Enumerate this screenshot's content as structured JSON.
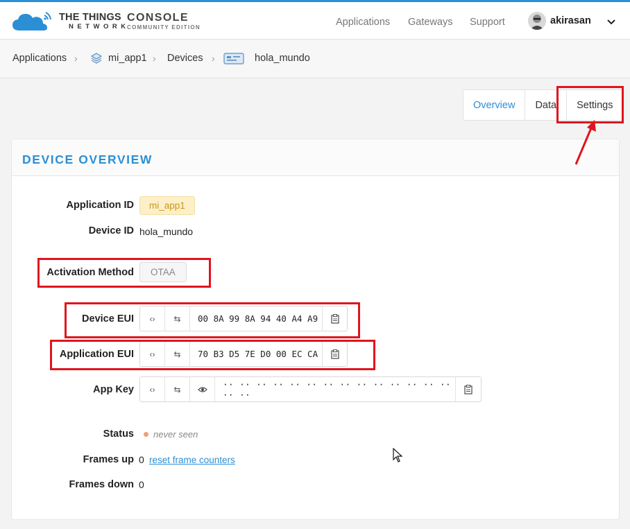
{
  "brand": {
    "line1": "THE THINGS",
    "line2": "NETWORK",
    "console": "CONSOLE",
    "edition": "COMMUNITY EDITION"
  },
  "nav": {
    "applications": "Applications",
    "gateways": "Gateways",
    "support": "Support",
    "username": "akirasan"
  },
  "breadcrumb": {
    "applications": "Applications",
    "app": "mi_app1",
    "devices": "Devices",
    "device": "hola_mundo"
  },
  "tabs": {
    "overview": "Overview",
    "data": "Data",
    "settings": "Settings"
  },
  "card": {
    "title": "DEVICE OVERVIEW",
    "application_id_label": "Application ID",
    "application_id": "mi_app1",
    "device_id_label": "Device ID",
    "device_id": "hola_mundo",
    "activation_label": "Activation Method",
    "activation": "OTAA",
    "device_eui_label": "Device EUI",
    "device_eui": "00 8A 99 8A 94 40 A4 A9",
    "app_eui_label": "Application EUI",
    "app_eui": "70 B3 D5 7E D0 00 EC CA",
    "app_key_label": "App Key",
    "app_key": "·· ·· ·· ·· ·· ·· ·· ·· ·· ·· ·· ·· ·· ·· ·· ··",
    "status_label": "Status",
    "status": "never seen",
    "frames_up_label": "Frames up",
    "frames_up": "0",
    "reset_link": "reset frame counters",
    "frames_down_label": "Frames down",
    "frames_down": "0"
  },
  "colors": {
    "accent": "#2b8fd6",
    "annotation": "#e0141e",
    "status_dot": "#f1a071"
  }
}
